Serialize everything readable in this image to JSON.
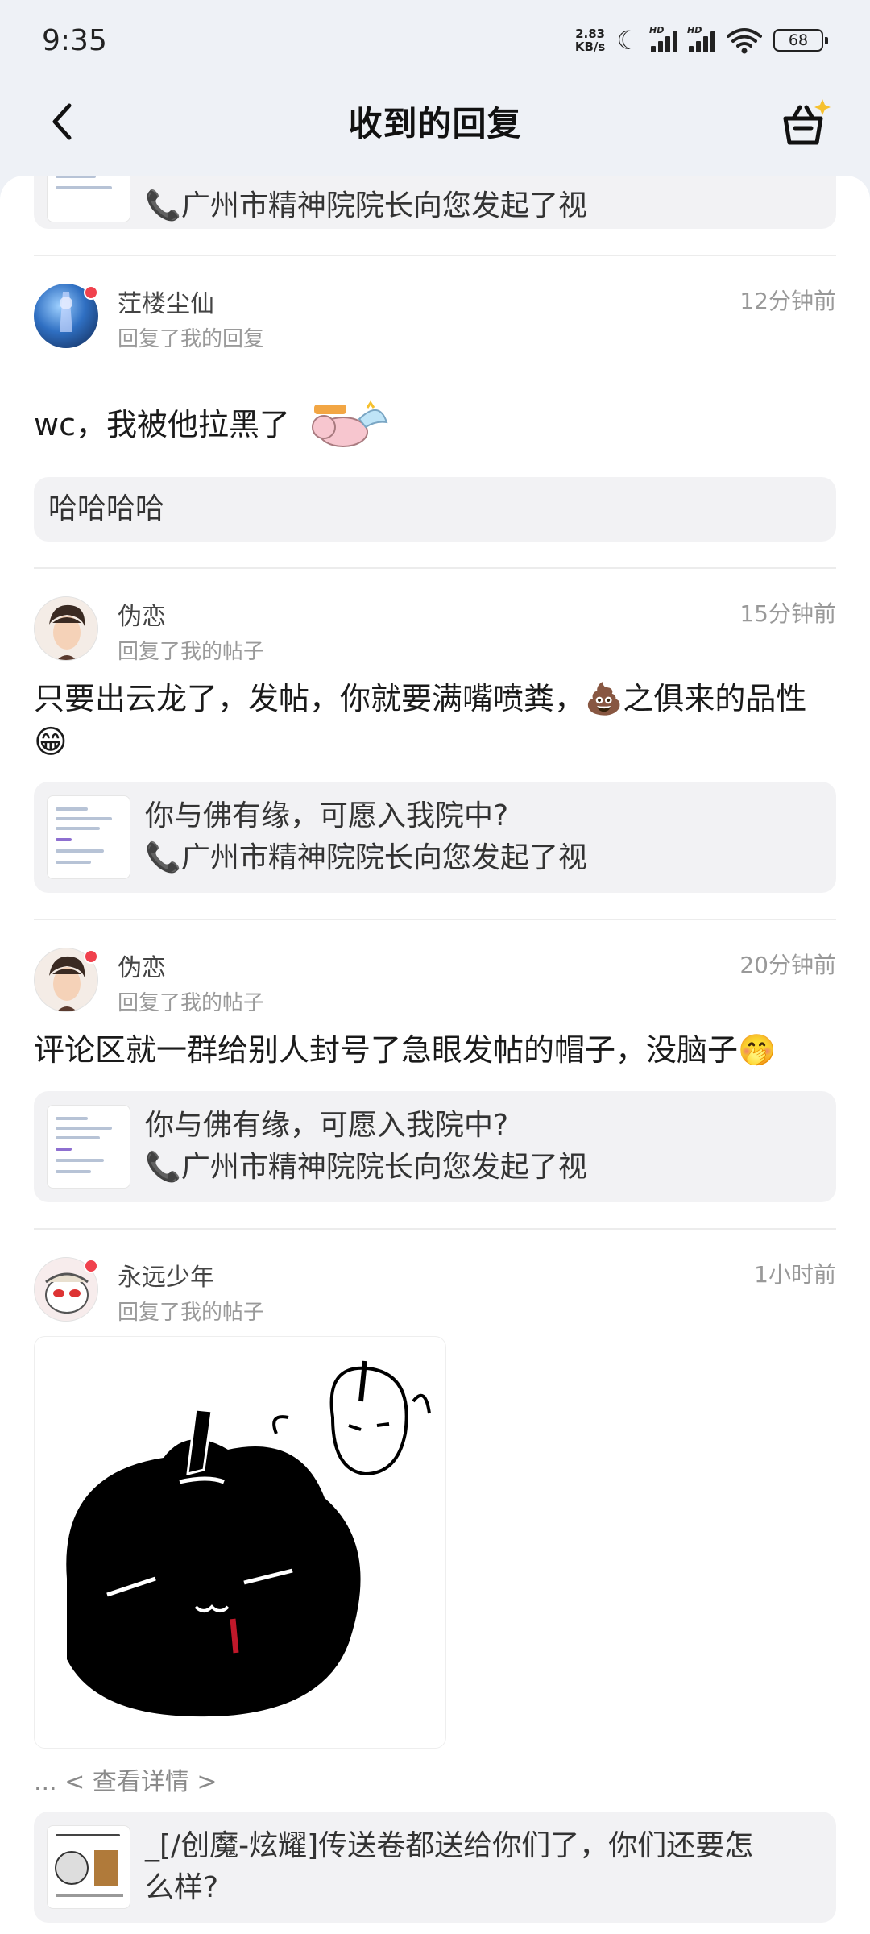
{
  "status_bar": {
    "time": "9:35",
    "net_speed_value": "2.83",
    "net_speed_unit": "KB/s",
    "sim1_label": "HD",
    "sim2_label": "HD",
    "battery": "68"
  },
  "nav": {
    "title": "收到的回复"
  },
  "replies": [
    {
      "quote_line2": "📞广州市精神院院长向您发起了视"
    },
    {
      "username": "茳楼尘仙",
      "action": "回复了我的回复",
      "time_ago": "12分钟前",
      "text": "wc，我被他拉黑了",
      "quote": "哈哈哈哈"
    },
    {
      "username": "伪恋",
      "action": "回复了我的帖子",
      "time_ago": "15分钟前",
      "text_line1": "只要出云龙了，发帖，你就要满嘴喷粪，💩之俱来的品性",
      "text_line2": "😁",
      "quote_line1": "你与佛有缘，可愿入我院中?",
      "quote_line2": "📞广州市精神院院长向您发起了视"
    },
    {
      "username": "伪恋",
      "action": "回复了我的帖子",
      "time_ago": "20分钟前",
      "text": "评论区就一群给别人封号了急眼发帖的帽子，没脑子🤭",
      "quote_line1": "你与佛有缘，可愿入我院中?",
      "quote_line2": "📞广州市精神院院长向您发起了视"
    },
    {
      "username": "永远少年",
      "action": "回复了我的帖子",
      "time_ago": "1小时前",
      "view_more": "... < 查看详情 >",
      "quote_line1": "_[/创魔-炫耀]传送卷都送给你们了，你们还要怎",
      "quote_line2": "么样?"
    }
  ],
  "colors": {
    "background": "#eef1f6",
    "unread_dot": "#f0414d",
    "quote_bg": "#f2f2f4"
  }
}
